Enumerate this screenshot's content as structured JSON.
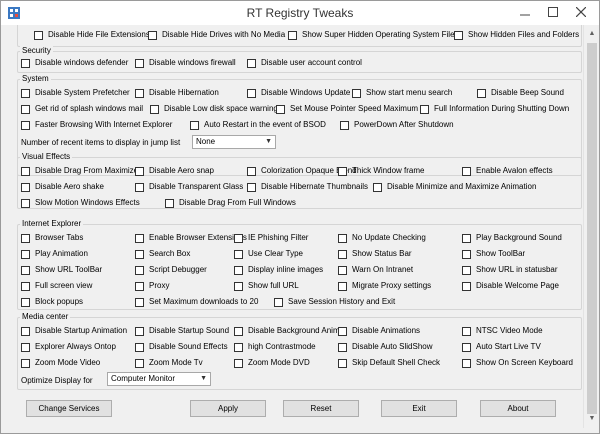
{
  "window": {
    "title": "RT Registry Tweaks"
  },
  "explorer_view": {
    "items": [
      "Disable Hide File Extensions",
      "Disable Hide Drives with No Media",
      "Show Super Hidden Operating System Files",
      "Show Hidden Files and Folders"
    ]
  },
  "security": {
    "title": "Security",
    "items": [
      "Disable windows defender",
      "Disable windows firewall",
      "Disable user account control"
    ]
  },
  "system": {
    "title": "System",
    "items": [
      "Disable System Prefetcher",
      "Disable Hibernation",
      "Disable Windows Update",
      "Show start menu search",
      "Disable Beep Sound",
      "Get rid of splash windows mail",
      "Disable Low disk space warning",
      "Set Mouse Pointer Speed Maximum",
      "Full Information During Shutting Down",
      "Faster Browsing With Internet Explorer",
      "Auto Restart in the event of BSOD",
      "PowerDown After Shutdown"
    ],
    "jump_label": "Number of recent items to display in jump list",
    "jump_value": "None"
  },
  "visual": {
    "title": "Visual Effects",
    "items": [
      "Disable Drag From Maximize",
      "Disable Aero snap",
      "Colorization Opaque Blend",
      "Thick Window frame",
      "Enable Avalon effects",
      "Disable Aero shake",
      "Disable Transparent Glass",
      "Disable Hibernate Thumbnails",
      "Disable Minimize and Maximize Animation",
      "Slow Motion Windows Effects",
      "Disable Drag From Full Windows"
    ]
  },
  "ie": {
    "title": "Internet Explorer",
    "items": [
      "Browser Tabs",
      "Enable Browser Extensions",
      "IE Phishing Filter",
      "No Update Checking",
      "Play Background Sound",
      "Play Animation",
      "Search Box",
      "Use Clear Type",
      "Show Status Bar",
      "Show ToolBar",
      "Show URL ToolBar",
      "Script Debugger",
      "Display inline images",
      "Warn On Intranet",
      "Show URL in statusbar",
      "Full screen view",
      "Proxy",
      "Show full URL",
      "Migrate Proxy settings",
      "Disable Welcome Page",
      "Block popups",
      "Set Maximum downloads to 20",
      "Save Session History and Exit"
    ]
  },
  "media": {
    "title": "Media center",
    "items": [
      "Disable Startup Animation",
      "Disable Startup Sound",
      "Disable Background Anima",
      "Disable Animations",
      "NTSC Video Mode",
      "Explorer Always Ontop",
      "Disable Sound Effects",
      "high Contrastmode",
      "Disable Auto SlidShow",
      "Auto Start Live TV",
      "Zoom Mode Video",
      "Zoom Mode Tv",
      "Zoom Mode DVD",
      "Skip Default Shell Check",
      "Show On Screen Keyboard"
    ],
    "opt_label": "Optimize Display for",
    "opt_value": "Computer Monitor"
  },
  "buttons": {
    "change_services": "Change Services",
    "apply": "Apply",
    "reset": "Reset",
    "exit": "Exit",
    "about": "About"
  }
}
